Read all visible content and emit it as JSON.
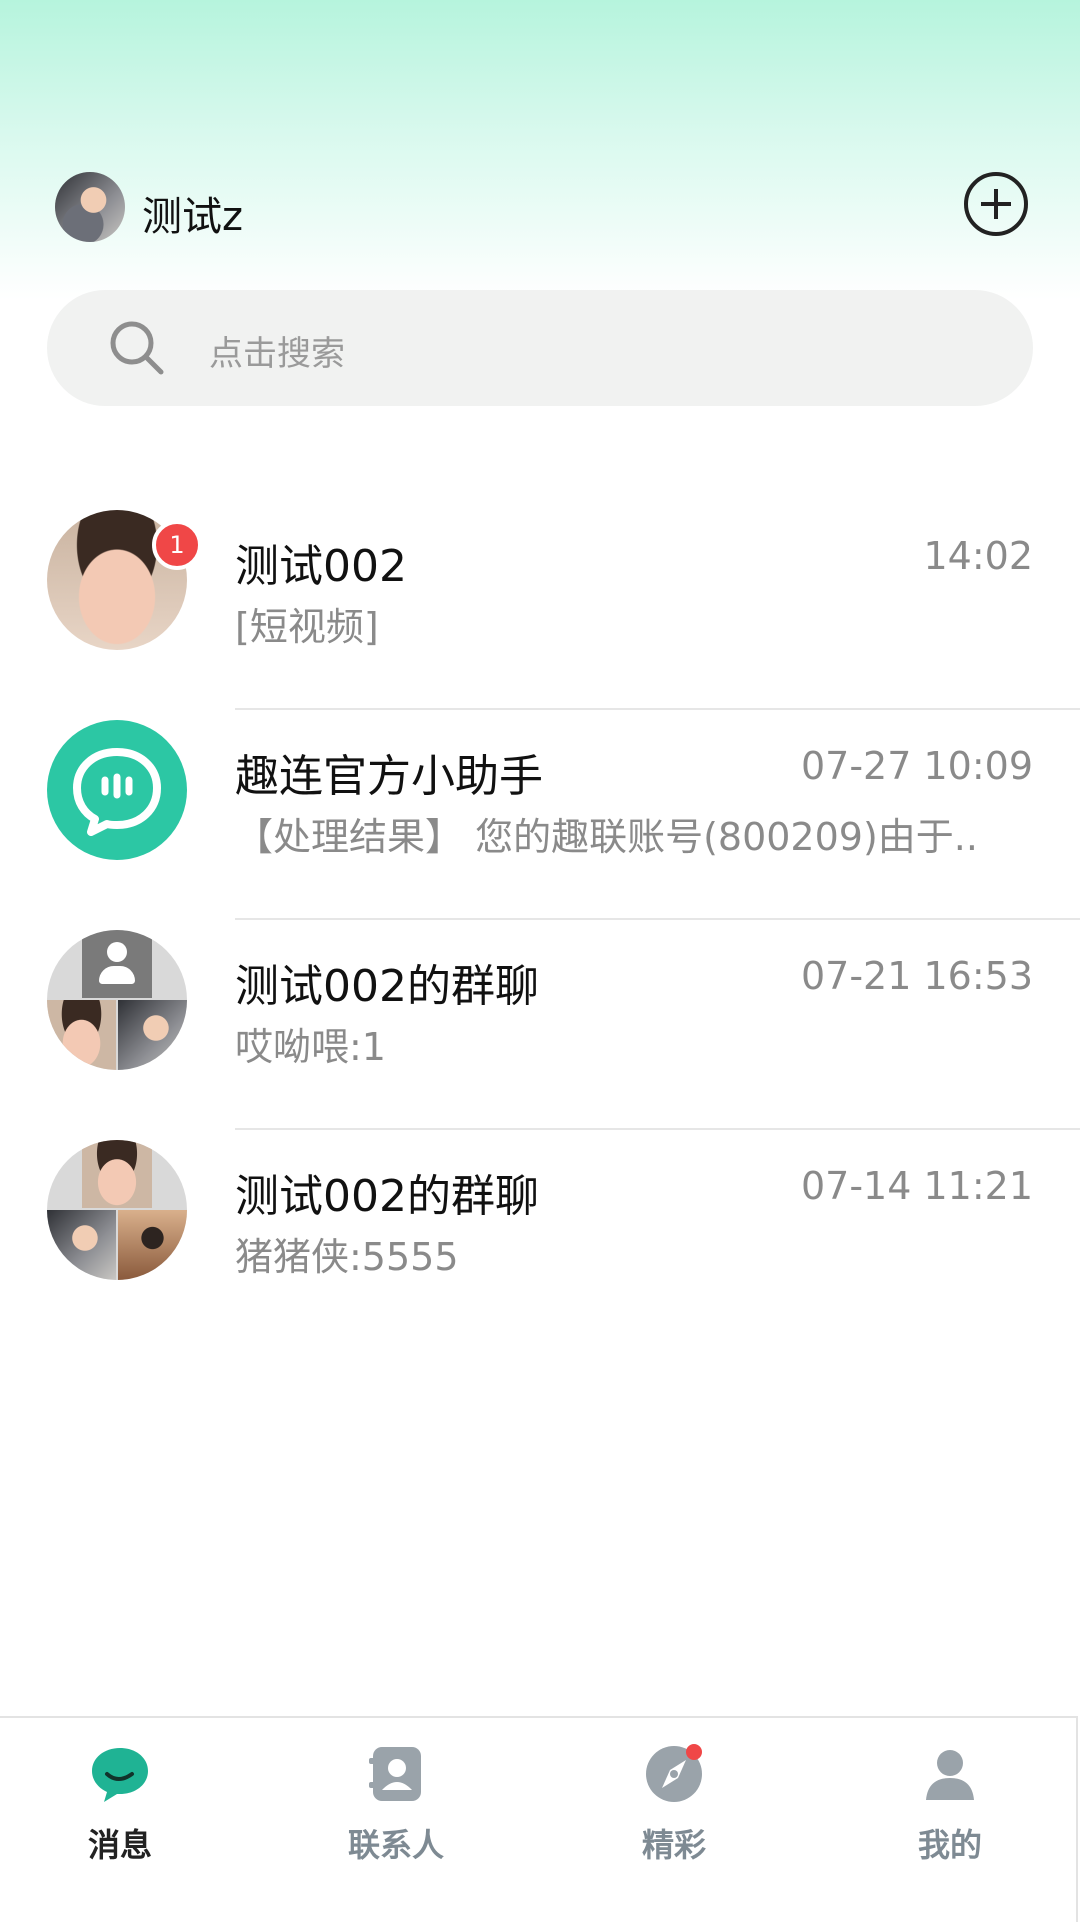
{
  "header": {
    "username": "测试z",
    "add_icon": "plus-circle-icon"
  },
  "search": {
    "placeholder": "点击搜索",
    "icon": "search-icon"
  },
  "chats": [
    {
      "name": "测试002",
      "time": "14:02",
      "preview": "[短视频]",
      "unread": "1",
      "avatar": "baby-photo"
    },
    {
      "name": "趣连官方小助手",
      "time": "07-27 10:09",
      "preview": "【处理结果】 您的趣联账号(800209)由于..",
      "avatar": "chat-bubble-icon"
    },
    {
      "name": "测试002的群聊",
      "time": "07-21 16:53",
      "preview": "哎呦喂:1",
      "avatar": "group-collage"
    },
    {
      "name": "测试002的群聊",
      "time": "07-14 11:21",
      "preview": "猪猪侠:5555",
      "avatar": "group-collage"
    }
  ],
  "nav": [
    {
      "label": "消息",
      "icon": "message-icon",
      "active": true
    },
    {
      "label": "联系人",
      "icon": "contacts-icon",
      "active": false
    },
    {
      "label": "精彩",
      "icon": "compass-icon",
      "active": false,
      "dot": true
    },
    {
      "label": "我的",
      "icon": "profile-icon",
      "active": false
    }
  ],
  "colors": {
    "accent": "#1fb394",
    "badge": "#f04747",
    "assistant_avatar": "#2cc7a4"
  }
}
